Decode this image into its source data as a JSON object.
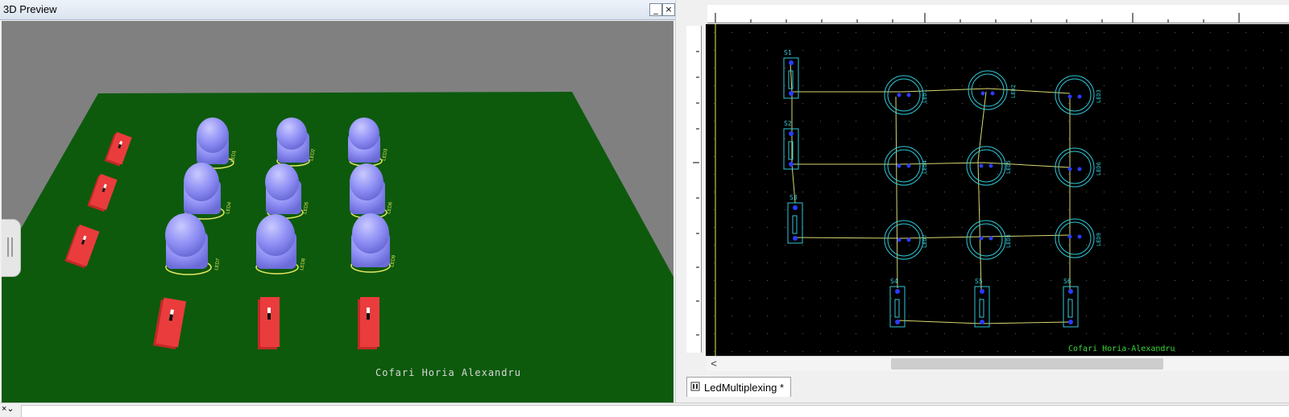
{
  "preview": {
    "title": "3D Preview",
    "minimize_label": "_",
    "close_label": "×",
    "author_text": "Cofari Horia Alexandru",
    "led_labels": [
      "LED1",
      "LED2",
      "LED3",
      "LED4",
      "LED5",
      "LED6",
      "LED7",
      "LED8",
      "LED9"
    ]
  },
  "editor": {
    "pcb_author_text": "Cofari Horia-Alexandru",
    "switch_labels": [
      "S1",
      "S2",
      "S3",
      "S4",
      "S5",
      "S6"
    ],
    "led_labels": [
      "LED1",
      "LED2",
      "LED3",
      "LED4",
      "LED5",
      "LED6",
      "LED7",
      "LED8",
      "LED9"
    ],
    "scroll_left_glyph": "<",
    "tab_label": "LedMultiplexing *"
  },
  "status": {
    "toggle_glyph": "×⌄"
  },
  "colors": {
    "board_green": "#0d5a0d",
    "led_blue": "#8f8ff5",
    "switch_red": "#e33b3b",
    "trace_yellow": "#e0e070",
    "footprint_cyan": "#2fc9d8",
    "pad_blue": "#2a3cff"
  }
}
